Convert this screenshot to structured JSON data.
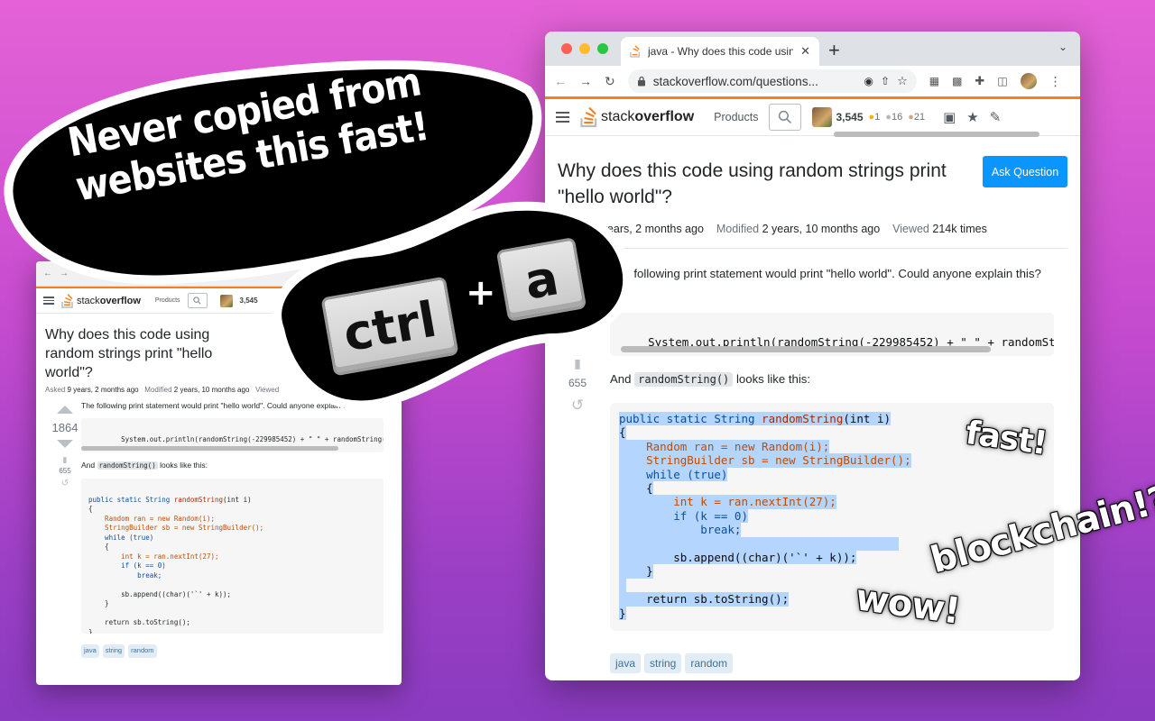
{
  "caption": {
    "line1": "Never copied from",
    "line2": "websites this fast!"
  },
  "keys": {
    "ctrl": "ctrl",
    "plus": "+",
    "a": "a"
  },
  "stickers": {
    "fast": "fast!",
    "blockchain": "blockchain!?",
    "wow": "wow!"
  },
  "browser": {
    "tab_title": "java - Why does this code usin",
    "url": "stackoverflow.com/questions...",
    "new_tab": "+"
  },
  "so": {
    "logo_part1": "stack",
    "logo_part2": "overflow",
    "products": "Products",
    "reputation": "3,545",
    "gold": "1",
    "silver": "16",
    "bronze": "21",
    "ask_button": "Ask Question"
  },
  "question": {
    "title": "Why does this code using random strings print \"hello world\"?",
    "asked_label": "Asked",
    "asked_value": "9 years, 2 months ago",
    "modified_label": "Modified",
    "modified_value": "2 years, 10 months ago",
    "viewed_label": "Viewed",
    "viewed_value": "214k times",
    "score": "1864",
    "bookmarks": "655",
    "body_text": "The following print statement would print \"hello world\". Could anyone explain this?",
    "code_line": "System.out.println(randomString(-229985452) + \" \" + randomString(-147909649));",
    "and_text_1": "And",
    "inline_code": "randomString()",
    "and_text_2": "looks like this:",
    "tags": [
      "java",
      "string",
      "random"
    ]
  },
  "code": {
    "l1a": "public static String ",
    "l1b": "randomString",
    "l1c": "(int i)",
    "l2": "{",
    "l3": "    Random ran = new Random(i);",
    "l4": "    StringBuilder sb = new StringBuilder();",
    "l5": "    while (true)",
    "l6": "    {",
    "l7": "        int k = ran.nextInt(27);",
    "l8": "        if (k == 0)",
    "l9": "            break;",
    "l10": "",
    "l11": "        sb.append((char)('`' + k));",
    "l12": "    }",
    "l13": "",
    "l14": "    return sb.toString();",
    "l15": "}"
  },
  "colors": {
    "accent": "#f48024",
    "ask_button": "#0a95ff",
    "selection": "#b4d5fe",
    "background_top": "#e462d6",
    "background_bottom": "#8a3bbf"
  }
}
